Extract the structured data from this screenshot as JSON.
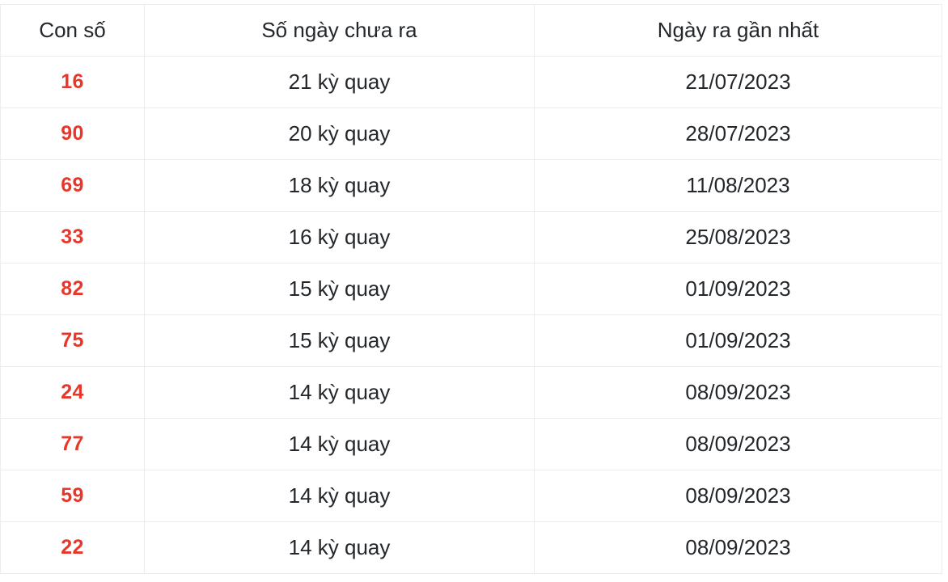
{
  "table": {
    "columns": [
      {
        "key": "number",
        "label": "Con số"
      },
      {
        "key": "days",
        "label": "Số ngày chưa ra"
      },
      {
        "key": "date",
        "label": "Ngày ra gần nhất"
      }
    ],
    "rows": [
      {
        "number": "16",
        "days": "21 kỳ quay",
        "date": "21/07/2023"
      },
      {
        "number": "90",
        "days": "20 kỳ quay",
        "date": "28/07/2023"
      },
      {
        "number": "69",
        "days": "18 kỳ quay",
        "date": "11/08/2023"
      },
      {
        "number": "33",
        "days": "16 kỳ quay",
        "date": "25/08/2023"
      },
      {
        "number": "82",
        "days": "15 kỳ quay",
        "date": "01/09/2023"
      },
      {
        "number": "75",
        "days": "15 kỳ quay",
        "date": "01/09/2023"
      },
      {
        "number": "24",
        "days": "14 kỳ quay",
        "date": "08/09/2023"
      },
      {
        "number": "77",
        "days": "14 kỳ quay",
        "date": "08/09/2023"
      },
      {
        "number": "59",
        "days": "14 kỳ quay",
        "date": "08/09/2023"
      },
      {
        "number": "22",
        "days": "14 kỳ quay",
        "date": "08/09/2023"
      }
    ],
    "colors": {
      "number_text": "#e8372a",
      "body_text": "#23272b",
      "border": "#ededed",
      "background": "#ffffff"
    }
  }
}
